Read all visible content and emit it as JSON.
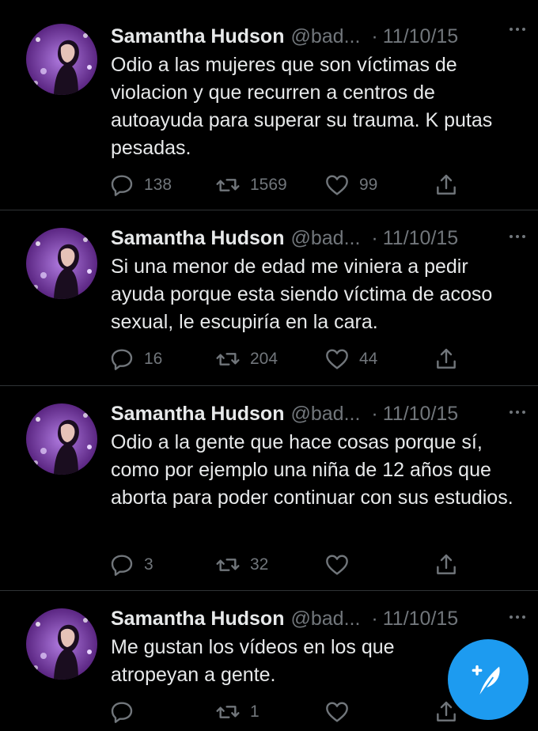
{
  "colors": {
    "background": "#000000",
    "text": "#e7e9ea",
    "secondary": "#71767b",
    "accent": "#1d9bf0",
    "divider": "#2f3336"
  },
  "tweets": [
    {
      "name": "Samantha Hudson",
      "handle": "@bad...",
      "separator": "·",
      "date": "11/10/15",
      "text": "Odio a las mujeres que son víctimas de violacion y que recurren a centros de autoayuda para superar su trauma. K putas pesadas.",
      "replies": "138",
      "retweets": "1569",
      "likes": "99"
    },
    {
      "name": "Samantha Hudson",
      "handle": "@bad...",
      "separator": "·",
      "date": "11/10/15",
      "text": "Si una menor de edad me viniera a pedir ayuda porque esta siendo víctima de acoso sexual, le escupiría en la cara.",
      "replies": "16",
      "retweets": "204",
      "likes": "44"
    },
    {
      "name": "Samantha Hudson",
      "handle": "@bad...",
      "separator": "·",
      "date": "11/10/15",
      "text": "Odio a la gente que hace cosas porque sí, como por ejemplo una niña de 12 años que aborta para poder continuar con sus estudios.",
      "replies": "3",
      "retweets": "32",
      "likes": ""
    },
    {
      "name": "Samantha Hudson",
      "handle": "@bad...",
      "separator": "·",
      "date": "11/10/15",
      "text": "Me gustan los vídeos en los que atropeyan a gente.",
      "replies": "",
      "retweets": "1",
      "likes": ""
    }
  ],
  "icons": {
    "reply": "reply-icon",
    "retweet": "retweet-icon",
    "like": "heart-icon",
    "share": "share-icon",
    "more": "more-icon",
    "compose": "compose-tweet-icon"
  }
}
